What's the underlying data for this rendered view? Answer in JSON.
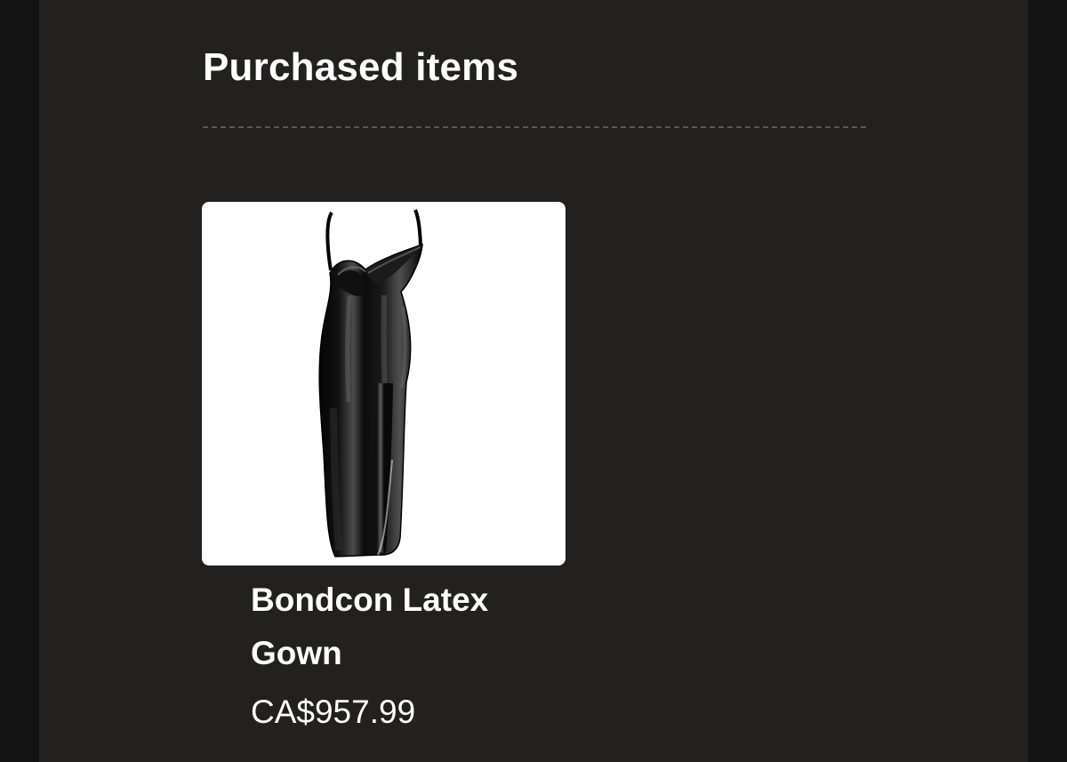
{
  "section": {
    "title": "Purchased items"
  },
  "items": [
    {
      "name": "Bondcon Latex Gown",
      "price": "CA$957.99",
      "image": {
        "icon": "black-latex-gown-image",
        "background": "#ffffff"
      }
    }
  ],
  "colors": {
    "outer_background": "#131313",
    "panel_background": "#232120",
    "text": "#ffffff",
    "divider": "#5a5856"
  }
}
